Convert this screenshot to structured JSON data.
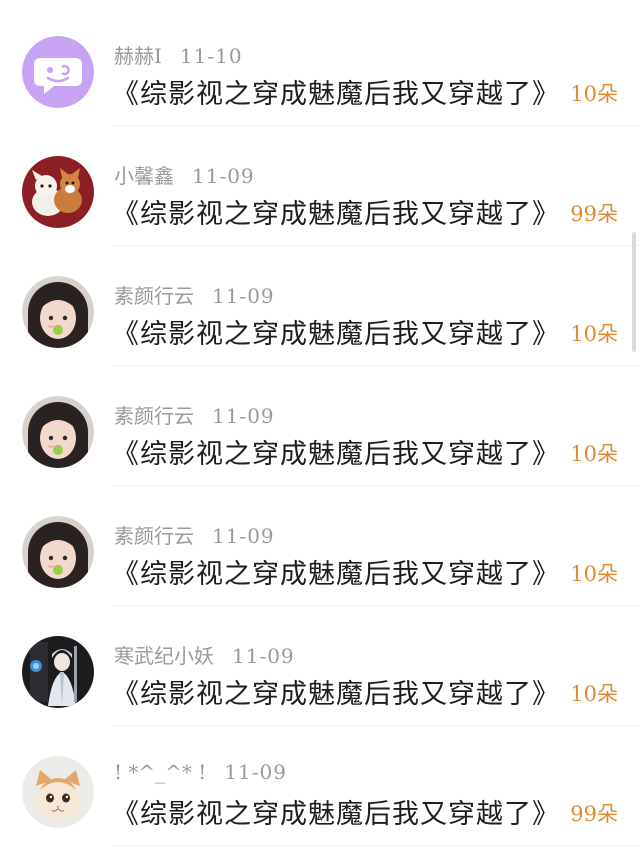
{
  "colors": {
    "username": "#9a9a9a",
    "message": "#1e1e1e",
    "gift": "#e08a32",
    "divider": "#efefef",
    "scrollbar": "#d9d9d9"
  },
  "comments": [
    {
      "avatar_icon": "purple-chat-bubble-avatar-icon",
      "username": "赫赫I",
      "date": "11-10",
      "message": "《综影视之穿成魅魔后我又穿越了》",
      "gift": "10朵"
    },
    {
      "avatar_icon": "two-dogs-photo-avatar-icon",
      "username": "小馨鑫",
      "date": "11-09",
      "message": "《综影视之穿成魅魔后我又穿越了》",
      "gift": "99朵"
    },
    {
      "avatar_icon": "girl-portrait-avatar-icon",
      "username": "素颜行云",
      "date": "11-09",
      "message": "《综影视之穿成魅魔后我又穿越了》",
      "gift": "10朵"
    },
    {
      "avatar_icon": "girl-portrait-avatar-icon",
      "username": "素颜行云",
      "date": "11-09",
      "message": "《综影视之穿成魅魔后我又穿越了》",
      "gift": "10朵"
    },
    {
      "avatar_icon": "girl-portrait-avatar-icon",
      "username": "素颜行云",
      "date": "11-09",
      "message": "《综影视之穿成魅魔后我又穿越了》",
      "gift": "10朵"
    },
    {
      "avatar_icon": "anime-character-avatar-icon",
      "username": "寒武纪小妖",
      "date": "11-09",
      "message": "《综影视之穿成魅魔后我又穿越了》",
      "gift": "10朵"
    },
    {
      "avatar_icon": "kitten-photo-avatar-icon",
      "username": "! *^_^* !",
      "date": "11-09",
      "message": "《综影视之穿成魅魔后我又穿越了》",
      "gift": "99朵"
    }
  ]
}
